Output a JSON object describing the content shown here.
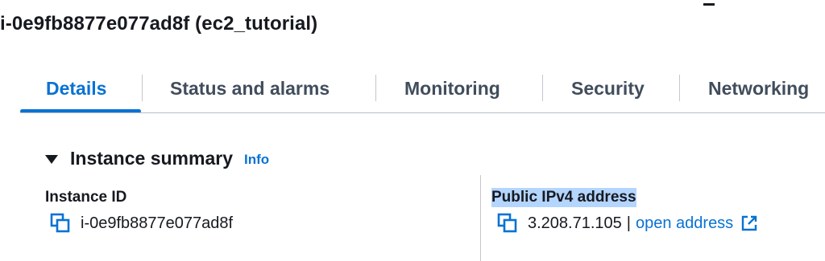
{
  "page": {
    "title": "i-0e9fb8877e077ad8f (ec2_tutorial)"
  },
  "tabs": [
    {
      "label": "Details",
      "active": true
    },
    {
      "label": "Status and alarms",
      "active": false
    },
    {
      "label": "Monitoring",
      "active": false
    },
    {
      "label": "Security",
      "active": false
    },
    {
      "label": "Networking",
      "active": false
    }
  ],
  "summary": {
    "title": "Instance summary",
    "info_label": "Info",
    "expanded": true
  },
  "fields": {
    "instance_id": {
      "label": "Instance ID",
      "value": "i-0e9fb8877e077ad8f",
      "icon": "copy-icon"
    },
    "public_ipv4": {
      "label": "Public IPv4 address",
      "value": "3.208.71.105",
      "separator": "|",
      "link_label": "open address",
      "icon": "copy-icon",
      "link_icon": "external-link-icon"
    }
  },
  "colors": {
    "accent": "#0972d3",
    "text": "#16191f",
    "tab_text": "#414d5c",
    "highlight": "#b4d5fe"
  }
}
